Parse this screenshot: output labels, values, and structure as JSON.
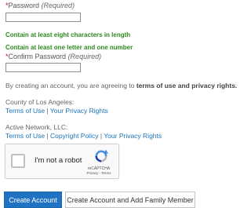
{
  "password": {
    "star": "*",
    "label": "Password",
    "required_note": "(Required)",
    "value": ""
  },
  "hints": {
    "length": "Contain at least eight characters in length",
    "letter_number": "Contain at least one letter and one number"
  },
  "confirm_password": {
    "star": "*",
    "label": "Confirm Password",
    "required_note": "(Required)",
    "value": ""
  },
  "agreement": {
    "prefix": "By creating an account, you are agreeing to ",
    "bold_text": "terms of use and privacy rights."
  },
  "county": {
    "name": "County of Los Angeles:",
    "links": [
      "Terms of Use",
      "Your Privacy Rights"
    ],
    "separator": "|"
  },
  "active_network": {
    "name": "Active Network, LLC:",
    "links": [
      "Terms of Use",
      "Copyright Policy",
      "Your Privacy Rights"
    ],
    "separator": "|"
  },
  "recaptcha": {
    "label": "I'm not a robot",
    "brand": "reCAPTCHA",
    "footer": "Privacy - Terms",
    "checked": false,
    "icon": "recaptcha-logo-icon"
  },
  "buttons": {
    "create_account": "Create Account",
    "create_with_family": "Create Account and Add Family Member"
  },
  "colors": {
    "required_star": "#d0021b",
    "hint_green": "#2e8b1f",
    "link_blue": "#1a73b8",
    "primary_button": "#1f73c2"
  }
}
